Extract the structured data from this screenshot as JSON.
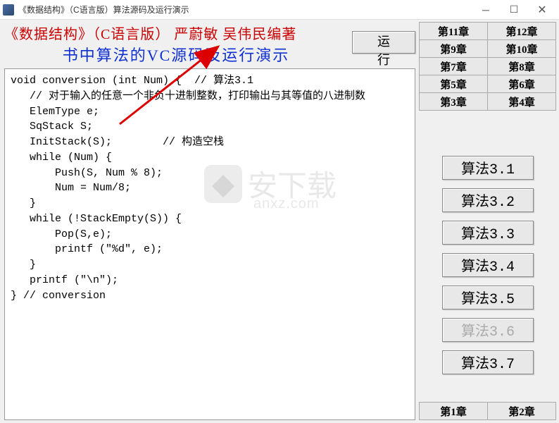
{
  "window": {
    "title": "《数据结构》（C语言版）算法源码及运行演示"
  },
  "header": {
    "line1": "《数据结构》（C语言版） 严蔚敏  吴伟民编著",
    "line2": "书中算法的VC源码及运行演示",
    "run_button": "运 行"
  },
  "chapters_top": [
    "第11章",
    "第12章",
    "第9章",
    "第10章",
    "第7章",
    "第8章",
    "第5章",
    "第6章",
    "第3章",
    "第4章"
  ],
  "chapters_bottom": [
    "第1章",
    "第2章"
  ],
  "algorithms": [
    {
      "label": "算法3.1",
      "disabled": false
    },
    {
      "label": "算法3.2",
      "disabled": false
    },
    {
      "label": "算法3.3",
      "disabled": false
    },
    {
      "label": "算法3.4",
      "disabled": false
    },
    {
      "label": "算法3.5",
      "disabled": false
    },
    {
      "label": "算法3.6",
      "disabled": true
    },
    {
      "label": "算法3.7",
      "disabled": false
    }
  ],
  "code": "void conversion (int Num) {  // 算法3.1\n   // 对于输入的任意一个非负十进制整数，打印输出与其等值的八进制数\n   ElemType e;\n   SqStack S;\n   InitStack(S);        // 构造空栈\n   while (Num) {\n       Push(S, Num % 8);\n       Num = Num/8;\n   }\n   while (!StackEmpty(S)) {\n       Pop(S,e);\n       printf (\"%d\", e);\n   }\n   printf (\"\\n\");\n} // conversion",
  "watermark": {
    "text": "安下载",
    "sub": "anxz.com"
  }
}
